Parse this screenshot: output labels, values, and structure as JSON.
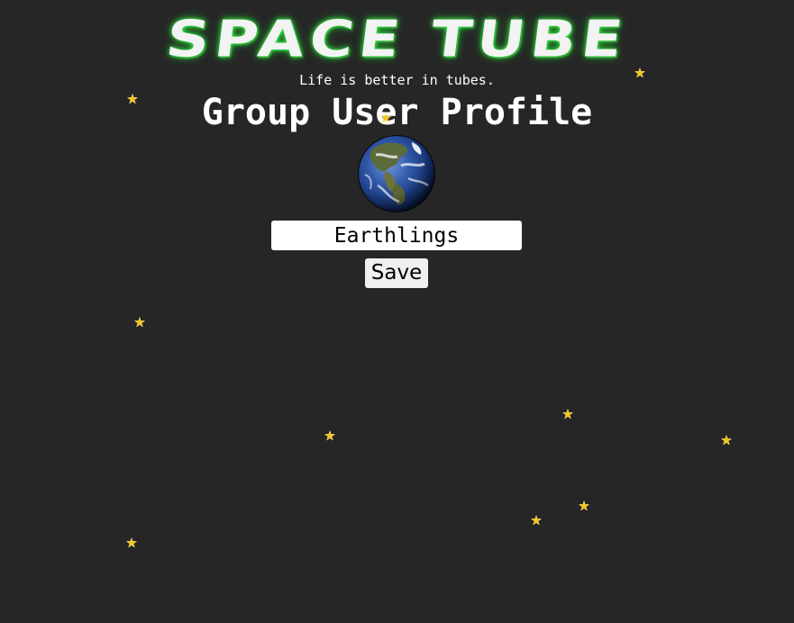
{
  "app": {
    "title": "SPACE TUBE",
    "tagline": "Life is better in tubes."
  },
  "page": {
    "title": "Group User Profile"
  },
  "profile": {
    "avatar_icon": "earth-globe-icon",
    "group_name": "Earthlings"
  },
  "actions": {
    "save_label": "Save"
  },
  "decor": {
    "star_icon": "star-icon",
    "star_color": "#f5c518",
    "logo_glow_color": "#3aff4a",
    "background_color": "#262626"
  }
}
